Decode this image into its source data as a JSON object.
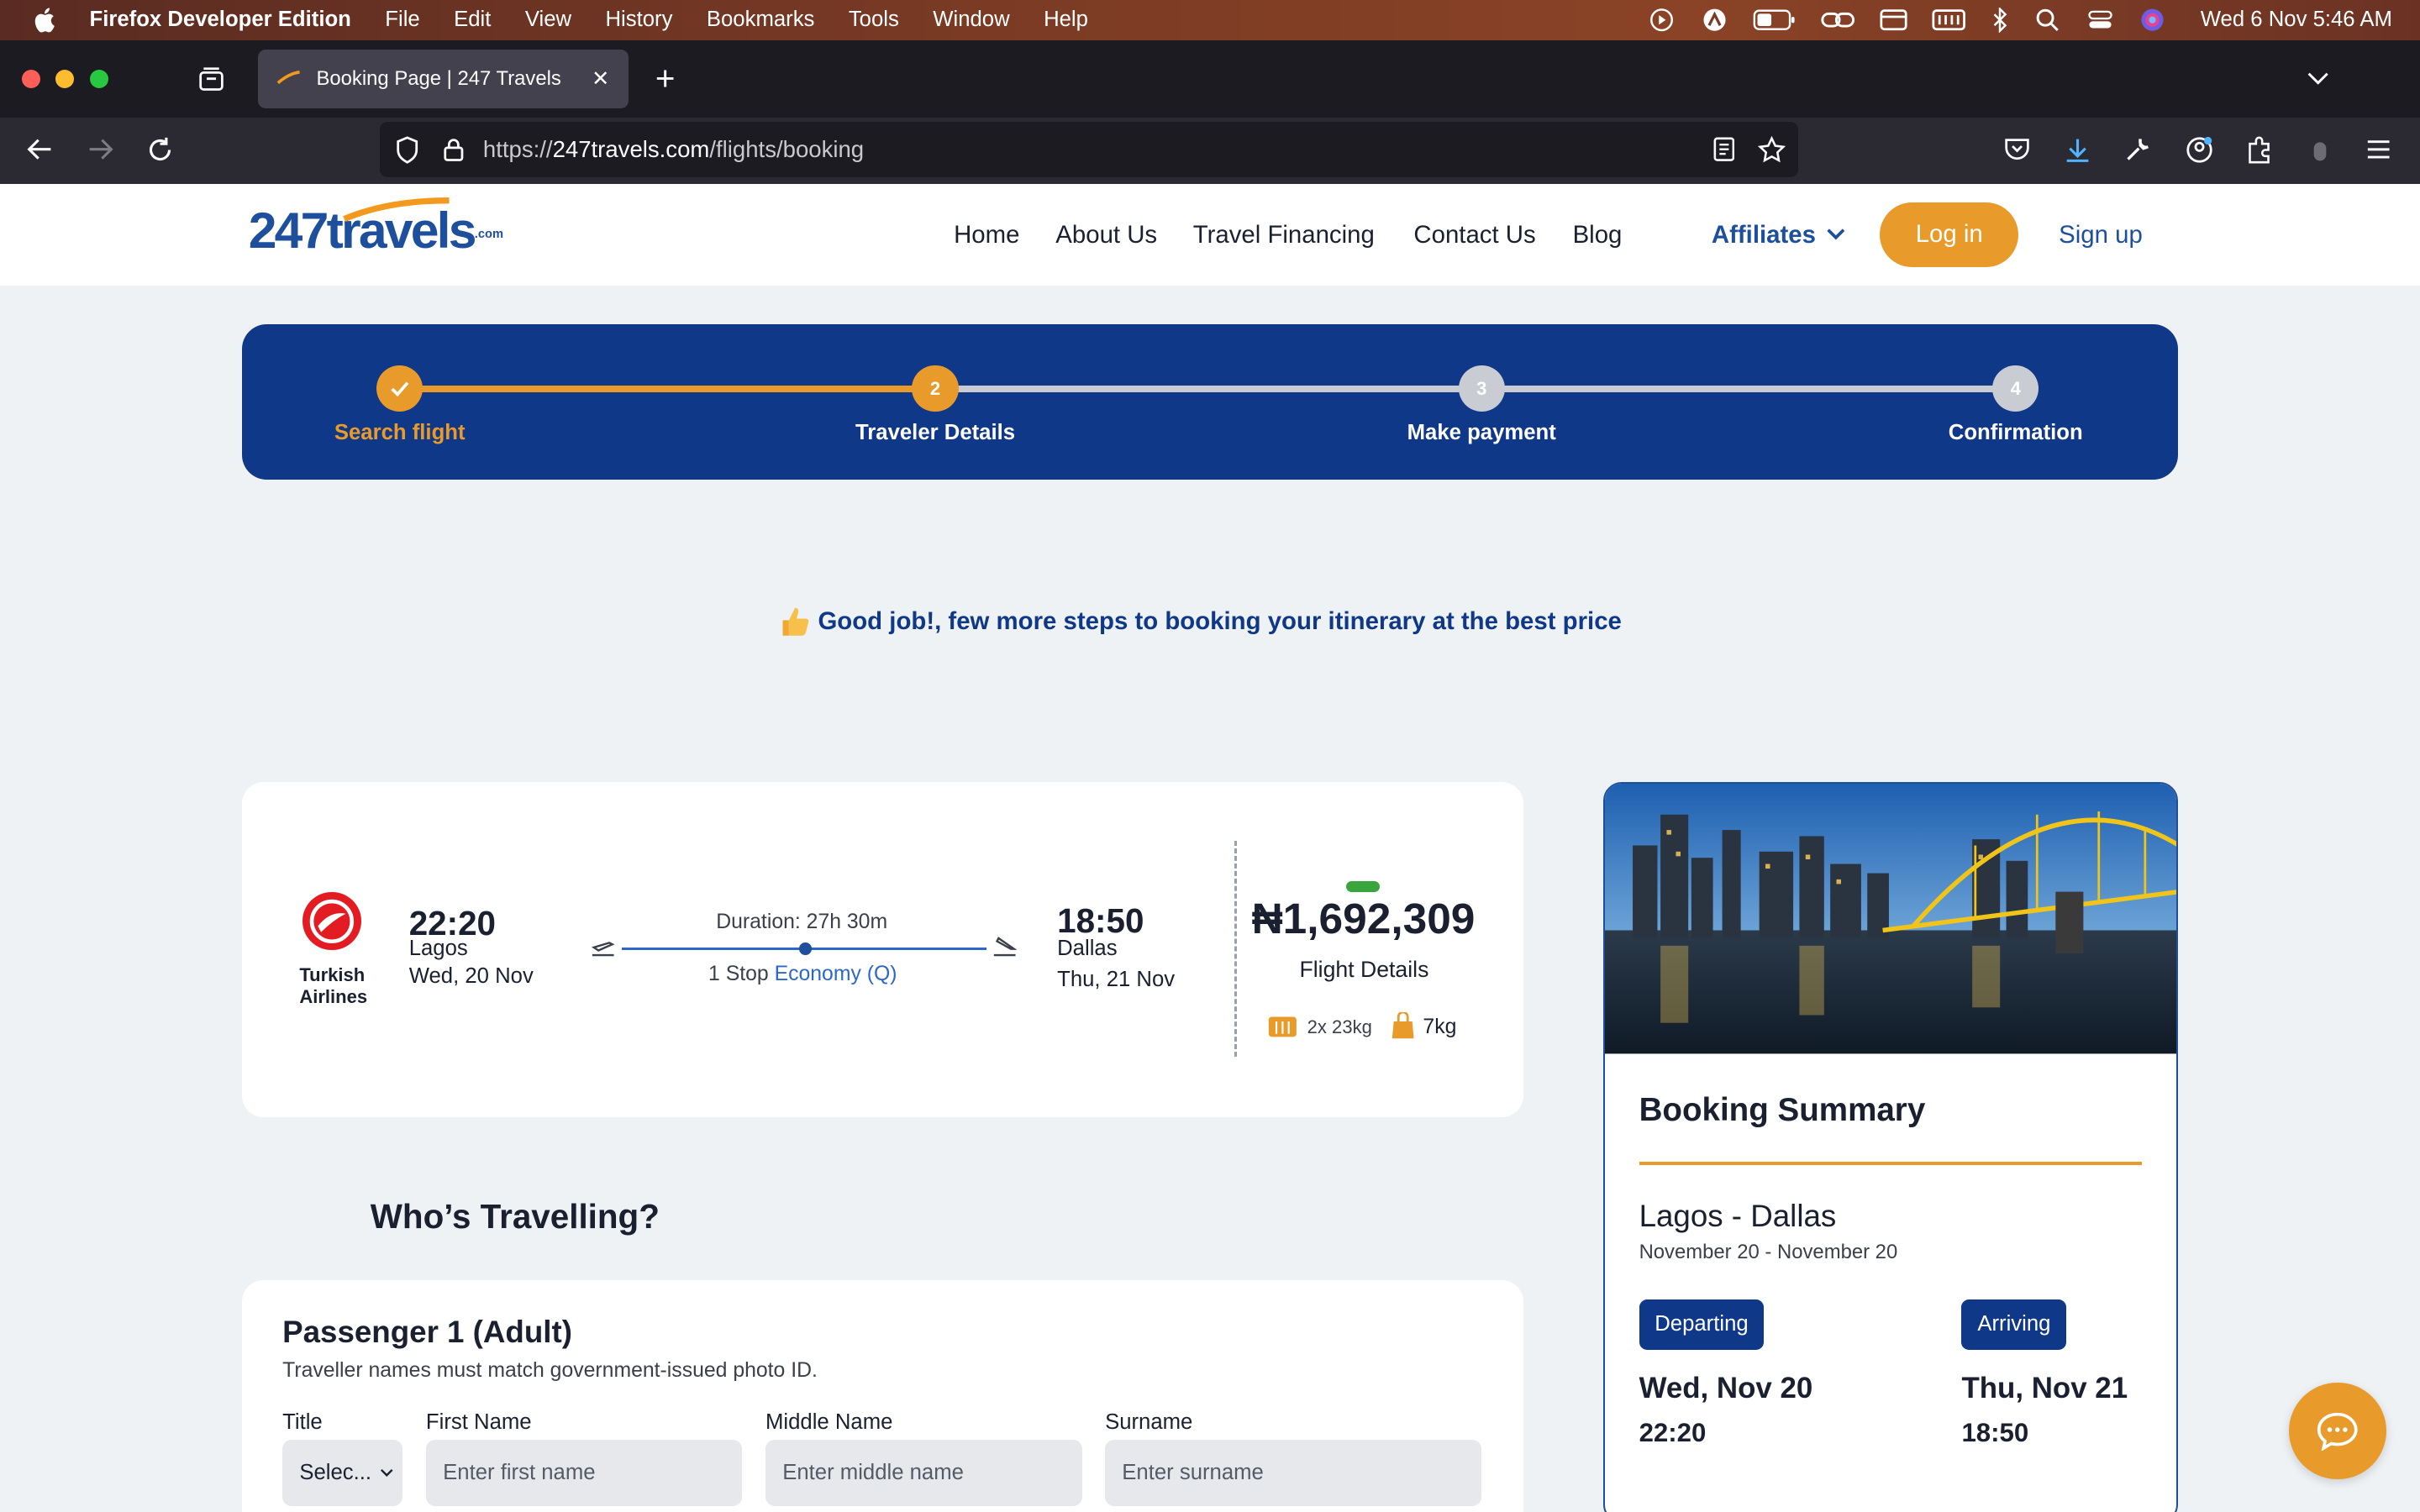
{
  "menubar": {
    "app_name": "Firefox Developer Edition",
    "items": [
      "File",
      "Edit",
      "View",
      "History",
      "Bookmarks",
      "Tools",
      "Window",
      "Help"
    ],
    "clock": "Wed 6 Nov  5:46 AM"
  },
  "browser": {
    "tab_title": "Booking Page | 247 Travels",
    "url_prefix": "https://",
    "url_host": "247travels.com",
    "url_path": "/flights/booking"
  },
  "site": {
    "logo_main": "247",
    "logo_rest": "travels",
    "logo_suffix": ".com",
    "nav": [
      "Home",
      "About Us",
      "Travel Financing",
      "Contact Us",
      "Blog"
    ],
    "affiliates": "Affiliates",
    "login": "Log in",
    "signup": "Sign up"
  },
  "stepper": {
    "steps": [
      {
        "label": "Search flight",
        "state": "done"
      },
      {
        "label": "Traveler Details",
        "number": "2",
        "state": "current"
      },
      {
        "label": "Make payment",
        "number": "3",
        "state": "upcoming"
      },
      {
        "label": "Confirmation",
        "number": "4",
        "state": "upcoming"
      }
    ],
    "accent_color": "#e89b2b",
    "background_color": "#0f3889"
  },
  "message": "Good job!, few more steps to booking your itinerary at the best price",
  "flight": {
    "airline": "Turkish Airlines",
    "airline_line1": "Turkish",
    "airline_line2": "Airlines",
    "depart_time": "22:20",
    "depart_city": "Lagos",
    "depart_date": "Wed, 20 Nov",
    "duration": "Duration: 27h 30m",
    "stops": "1 Stop",
    "cabin": "Economy (Q)",
    "arrive_time": "18:50",
    "arrive_city": "Dallas",
    "arrive_date": "Thu, 21 Nov",
    "price": "₦1,692,309",
    "details_link": "Flight Details",
    "baggage_checked": "2x 23kg",
    "baggage_cabin": "7kg"
  },
  "travellers": {
    "heading": "Who’s Travelling?",
    "passenger_title": "Passenger 1 (Adult)",
    "note": "Traveller names must match government-issued photo ID.",
    "fields": {
      "title_label": "Title",
      "title_value": "Selec...",
      "first_label": "First Name",
      "first_placeholder": "Enter first name",
      "middle_label": "Middle Name",
      "middle_placeholder": "Enter middle name",
      "surname_label": "Surname",
      "surname_placeholder": "Enter surname"
    }
  },
  "summary": {
    "title": "Booking Summary",
    "route": "Lagos - Dallas",
    "dates": "November 20 - November 20",
    "departing_label": "Departing",
    "departing_day": "Wed, Nov 20",
    "departing_time": "22:20",
    "arriving_label": "Arriving",
    "arriving_day": "Thu, Nov 21",
    "arriving_time": "18:50"
  }
}
